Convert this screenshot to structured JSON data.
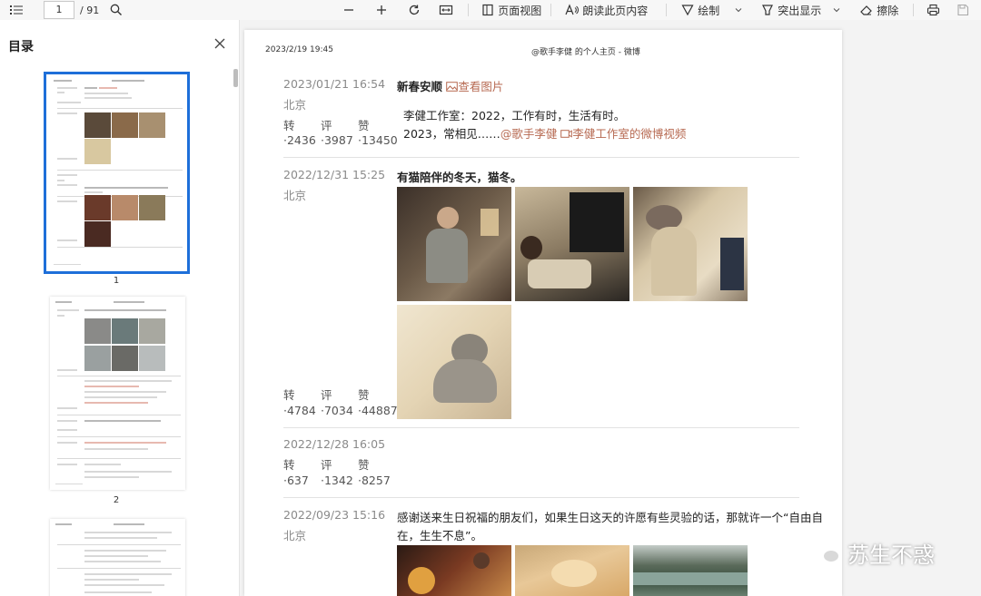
{
  "toolbar": {
    "page_input_value": "1",
    "page_total": "/ 91",
    "page_view_label": "页面视图",
    "read_aloud_label": "朗读此页内容",
    "draw_label": "绘制",
    "highlight_label": "突出显示",
    "erase_label": "擦除"
  },
  "sidebar": {
    "title": "目录",
    "thumbnails": [
      {
        "page_number": "1",
        "selected": true
      },
      {
        "page_number": "2",
        "selected": false
      }
    ]
  },
  "document": {
    "header_date": "2023/2/19 19:45",
    "header_title": "@歌手李健 的个人主页 - 微博",
    "stat_labels": {
      "repost": "转",
      "comment": "评",
      "like": "赞"
    },
    "posts": [
      {
        "date": "2023/01/21 16:54",
        "location": "北京",
        "title": "新春安顺",
        "view_image_link": "查看图片",
        "quote_line1": "李健工作室：2022，工作有时，生活有时。",
        "quote_line2_prefix": "2023，常相见……",
        "mention_link": "@歌手李健",
        "video_link": "李健工作室的微博视频",
        "repost": "·2436",
        "comment": "·3987",
        "like": "·13450"
      },
      {
        "date": "2022/12/31 15:25",
        "location": "北京",
        "text": "有猫陪伴的冬天，猫冬。",
        "repost": "·4784",
        "comment": "·7034",
        "like": "·44887"
      },
      {
        "date": "2022/12/28 16:05",
        "repost": "·637",
        "comment": "·1342",
        "like": "·8257"
      },
      {
        "date": "2022/09/23 15:16",
        "location": "北京",
        "text_line1": "感谢送来生日祝福的朋友们，如果生日这天的许愿有些灵验的话，那就许一个“自由自",
        "text_line2": "在，生生不息”。"
      }
    ]
  },
  "watermark": {
    "text": "苏生不惑"
  },
  "colors": {
    "accent": "#1e6fd9",
    "link": "#b76a52",
    "muted": "#8a8a8a"
  }
}
